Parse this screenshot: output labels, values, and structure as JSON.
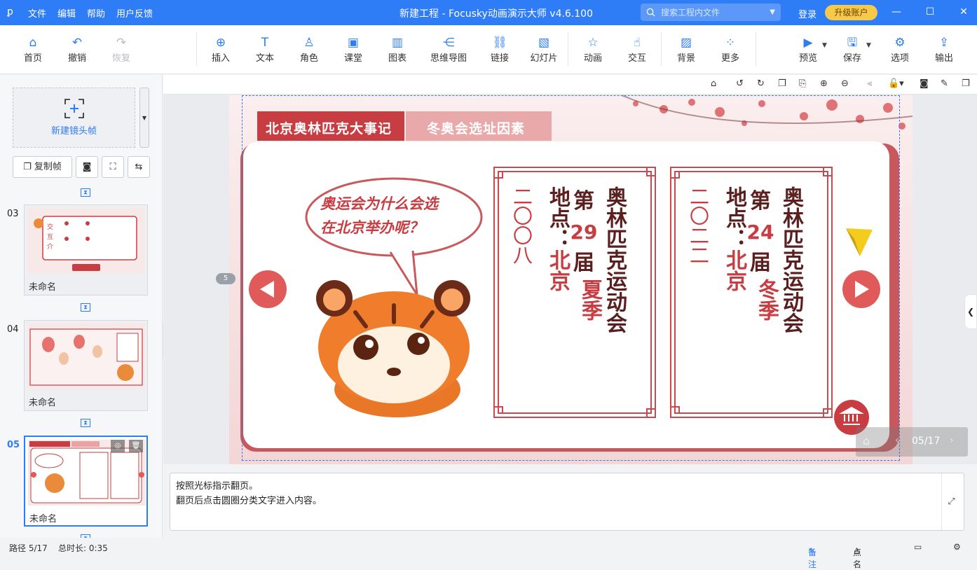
{
  "titlebar": {
    "logo_icon": "pin-icon",
    "menu": [
      "文件",
      "编辑",
      "帮助",
      "用户反馈"
    ],
    "title": "新建工程 - Focusky动画演示大师  v4.6.100",
    "search_placeholder": "搜索工程内文件",
    "login": "登录",
    "upgrade": "升级账户"
  },
  "toolbar": {
    "home": "首页",
    "undo": "撤销",
    "redo": "恢复",
    "insert": "插入",
    "text": "文本",
    "role": "角色",
    "classroom": "课堂",
    "chart": "图表",
    "mindmap": "思维导图",
    "link": "链接",
    "slides": "幻灯片",
    "animation": "动画",
    "interaction": "交互",
    "background": "背景",
    "more": "更多",
    "preview": "预览",
    "save": "保存",
    "options": "选项",
    "export": "输出"
  },
  "sidebar": {
    "new_frame": "新建镜头帧",
    "copy_frame": "复制帧",
    "thumbs": [
      {
        "num": "03",
        "name": "未命名"
      },
      {
        "num": "04",
        "name": "未命名"
      },
      {
        "num": "05",
        "name": "未命名"
      }
    ]
  },
  "slide": {
    "tab_active": "北京奥林匹克大事记",
    "tab_inactive": "冬奥会选址因素",
    "bubble": [
      "奥运会为什么会选",
      "在北京举办呢？"
    ],
    "col1": {
      "a": "奥林匹克运动会",
      "b_pre": "第",
      "b_num": "29",
      "b_post": "届",
      "b_season": "夏季",
      "c": "地点：",
      "c_city": "北京",
      "d": "二〇〇八"
    },
    "col2": {
      "a": "奥林匹克运动会",
      "b_pre": "第",
      "b_num": "24",
      "b_post": "届",
      "b_season": "冬季",
      "c": "地点：",
      "c_city": "北京",
      "d": "二〇二二"
    },
    "page_badge": "5"
  },
  "playnav": {
    "counter": "05/17"
  },
  "notes": {
    "line1": "按照光标指示翻页。",
    "line2": "翻页后点击圆圈分类文字进入内容。"
  },
  "status": {
    "path": "路径 5/17",
    "duration": "总时长: 0:35",
    "notes": "备注",
    "rollcall": "点名"
  },
  "colors": {
    "accent": "#2e7cf6",
    "slide_red": "#c83d42",
    "slide_dark": "#5b1f1f"
  }
}
